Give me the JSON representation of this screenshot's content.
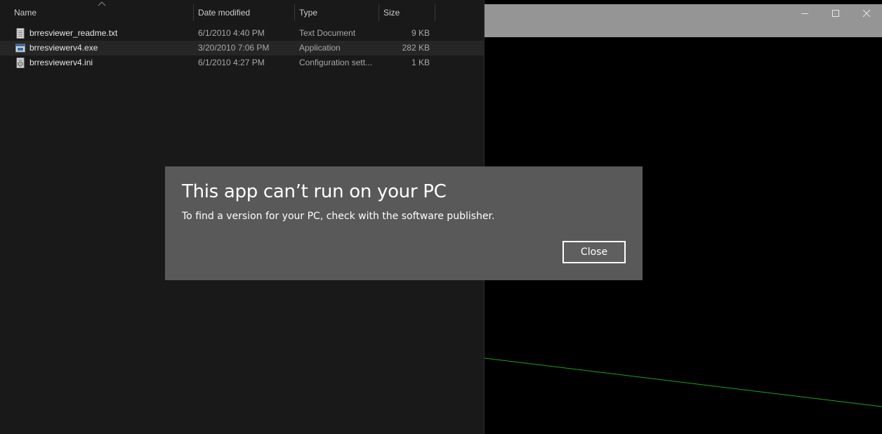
{
  "explorer": {
    "columns": {
      "name": "Name",
      "date": "Date modified",
      "type": "Type",
      "size": "Size"
    },
    "files": [
      {
        "name": "brresviewer_readme.txt",
        "date": "6/1/2010 4:40 PM",
        "type": "Text Document",
        "size": "9 KB",
        "icon": "text-file-icon"
      },
      {
        "name": "brresviewerv4.exe",
        "date": "3/20/2010 7:06 PM",
        "type": "Application",
        "size": "282 KB",
        "icon": "application-icon"
      },
      {
        "name": "brresviewerv4.ini",
        "date": "6/1/2010 4:27 PM",
        "type": "Configuration sett...",
        "size": "1 KB",
        "icon": "config-file-icon"
      }
    ]
  },
  "app_window": {
    "buttons": [
      "minimize-icon",
      "maximize-icon",
      "close-icon"
    ]
  },
  "dialog": {
    "title": "This app can’t run on your PC",
    "message": "To find a version for your PC, check with the software publisher.",
    "close_label": "Close"
  },
  "colors": {
    "explorer_bg": "#191919",
    "dialog_bg": "#595959",
    "titlebar_bg": "#959595",
    "line_color": "#1fa11f"
  }
}
